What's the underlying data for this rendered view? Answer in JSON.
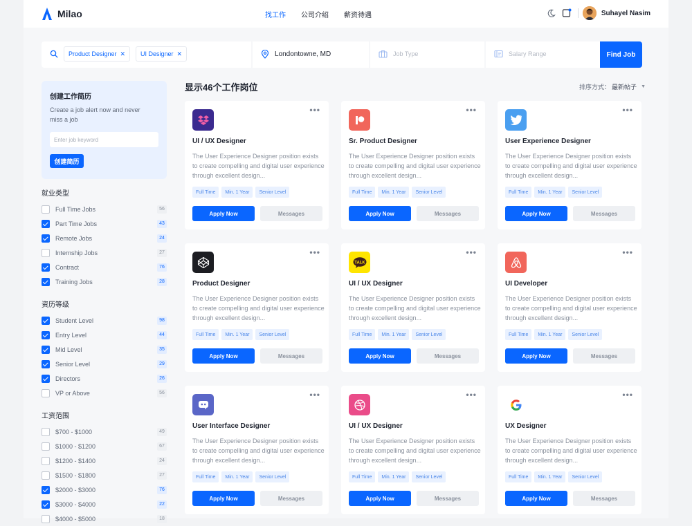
{
  "app": {
    "name": "Milao"
  },
  "nav": [
    {
      "label": "找工作",
      "active": true
    },
    {
      "label": "公司介绍",
      "active": false
    },
    {
      "label": "薪资待遇",
      "active": false
    }
  ],
  "user": {
    "name": "Suhayel Nasim"
  },
  "search": {
    "chips": [
      "Product Designer",
      "UI Designer"
    ],
    "location": "Londontowne, MD",
    "job_type_placeholder": "Job Type",
    "salary_placeholder": "Salary Range",
    "find_label": "Find Job"
  },
  "alert": {
    "title": "创建工作简历",
    "description": "Create a job alert now and never miss a job",
    "input_placeholder": "Enter job keyword",
    "button_label": "创建简历"
  },
  "filters": [
    {
      "title": "就业类型",
      "items": [
        {
          "label": "Full Time Jobs",
          "count": "56",
          "checked": false
        },
        {
          "label": "Part Time Jobs",
          "count": "43",
          "checked": true
        },
        {
          "label": "Remote Jobs",
          "count": "24",
          "checked": true
        },
        {
          "label": "Internship Jobs",
          "count": "27",
          "checked": false
        },
        {
          "label": "Contract",
          "count": "76",
          "checked": true
        },
        {
          "label": "Training Jobs",
          "count": "28",
          "checked": true
        }
      ]
    },
    {
      "title": "资历等级",
      "items": [
        {
          "label": "Student Level",
          "count": "98",
          "checked": true
        },
        {
          "label": "Entry Level",
          "count": "44",
          "checked": true
        },
        {
          "label": "Mid Level",
          "count": "35",
          "checked": true
        },
        {
          "label": "Senior Level",
          "count": "29",
          "checked": true
        },
        {
          "label": "Directors",
          "count": "26",
          "checked": true
        },
        {
          "label": "VP or Above",
          "count": "56",
          "checked": false
        }
      ]
    },
    {
      "title": "工资范围",
      "items": [
        {
          "label": "$700 - $1000",
          "count": "49",
          "checked": false
        },
        {
          "label": "$1000 - $1200",
          "count": "67",
          "checked": false
        },
        {
          "label": "$1200 - $1400",
          "count": "24",
          "checked": false
        },
        {
          "label": "$1500 - $1800",
          "count": "27",
          "checked": false
        },
        {
          "label": "$2000 - $3000",
          "count": "76",
          "checked": true
        },
        {
          "label": "$3000 - $4000",
          "count": "22",
          "checked": true
        },
        {
          "label": "$4000 - $5000",
          "count": "18",
          "checked": false
        }
      ]
    }
  ],
  "results": {
    "title": "显示46个工作岗位",
    "sort_label": "排序方式：",
    "sort_value": "最新帖子"
  },
  "card_common": {
    "description": "The User Experience Designer position exists to create compelling and digital user experience through excellent design...",
    "tags": [
      "Full Time",
      "Min. 1 Year",
      "Senior Level"
    ],
    "apply_label": "Apply Now",
    "messages_label": "Messages",
    "more": "•••"
  },
  "jobs": [
    {
      "title": "UI / UX Designer",
      "logo": "dropbox-icon",
      "color": "#3b2a8f"
    },
    {
      "title": "Sr. Product Designer",
      "logo": "patreon-icon",
      "color": "#f1665b"
    },
    {
      "title": "User Experience Designer",
      "logo": "twitter-icon",
      "color": "#4a9ff0"
    },
    {
      "title": "Product Designer",
      "logo": "codepen-icon",
      "color": "#1c1d22"
    },
    {
      "title": "UI / UX Designer",
      "logo": "kakaotalk-icon",
      "color": "#ffe500"
    },
    {
      "title": "UI Developer",
      "logo": "airbnb-icon",
      "color": "#f1665b"
    },
    {
      "title": "User Interface Designer",
      "logo": "discord-icon",
      "color": "#5a66c7"
    },
    {
      "title": "UI / UX Designer",
      "logo": "dribbble-icon",
      "color": "#ea4c89"
    },
    {
      "title": "UX Designer",
      "logo": "google-icon",
      "color": "#ffffff"
    }
  ]
}
